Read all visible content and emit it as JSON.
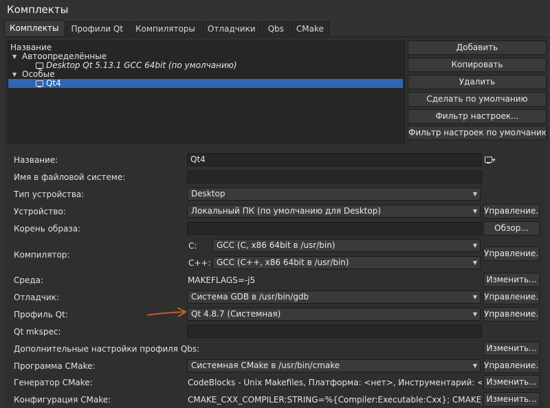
{
  "window": {
    "title": "Комплекты"
  },
  "tabs": [
    "Комплекты",
    "Профили Qt",
    "Компиляторы",
    "Отладчики",
    "Qbs",
    "CMake"
  ],
  "tree": {
    "header": "Название",
    "groups": [
      {
        "label": "Автоопределённые",
        "items": [
          "Desktop Qt 5.13.1 GCC 64bit (по умолчанию)"
        ]
      },
      {
        "label": "Особые",
        "items": [
          "Qt4"
        ]
      }
    ]
  },
  "actions": {
    "add": "Добавить",
    "copy": "Копировать",
    "delete": "Удалить",
    "make_default": "Сделать по умолчанию",
    "settings_filter": "Фильтр настроек...",
    "default_settings_filter": "Фильтр настроек по умолчанию..."
  },
  "form": {
    "name_label": "Название:",
    "name_value": "Qt4",
    "fs_name_label": "Имя в файловой системе:",
    "fs_name_value": "",
    "device_type_label": "Тип устройства:",
    "device_type_value": "Desktop",
    "device_label": "Устройство:",
    "device_value": "Локальный ПК (по умолчанию для Desktop)",
    "sysroot_label": "Корень образа:",
    "sysroot_value": "",
    "compiler_label": "Компилятор:",
    "compiler_c_label": "C:",
    "compiler_c_value": "GCC (C, x86 64bit в /usr/bin)",
    "compiler_cxx_label": "C++:",
    "compiler_cxx_value": "GCC (C++, x86 64bit в /usr/bin)",
    "env_label": "Среда:",
    "env_value": "MAKEFLAGS=-j5",
    "debugger_label": "Отладчик:",
    "debugger_value": "Система GDB в /usr/bin/gdb",
    "qt_profile_label": "Профиль Qt:",
    "qt_profile_value": "Qt 4.8.7 (Системная)",
    "mkspec_label": "Qt mkspec:",
    "mkspec_value": "",
    "qbs_label": "Дополнительные настройки профиля Qbs:",
    "cmake_label": "Программа CMake:",
    "cmake_value": "Системная CMake в /usr/bin/cmake",
    "cmake_gen_label": "Генератор CMake:",
    "cmake_gen_value": "CodeBlocks - Unix Makefiles, Платформа: <нет>, Инструментарий: <нет>",
    "cmake_conf_label": "Конфигурация CMake:",
    "cmake_conf_value": "CMAKE_CXX_COMPILER:STRING=%{Compiler:Executable:Cxx}; CMAKE_C_C..."
  },
  "side_buttons": {
    "manage": "Управление...",
    "browse": "Обзор...",
    "change": "Изменить..."
  },
  "colors": {
    "selection": "#2f65b4",
    "annotation_arrow": "#c0602a"
  }
}
